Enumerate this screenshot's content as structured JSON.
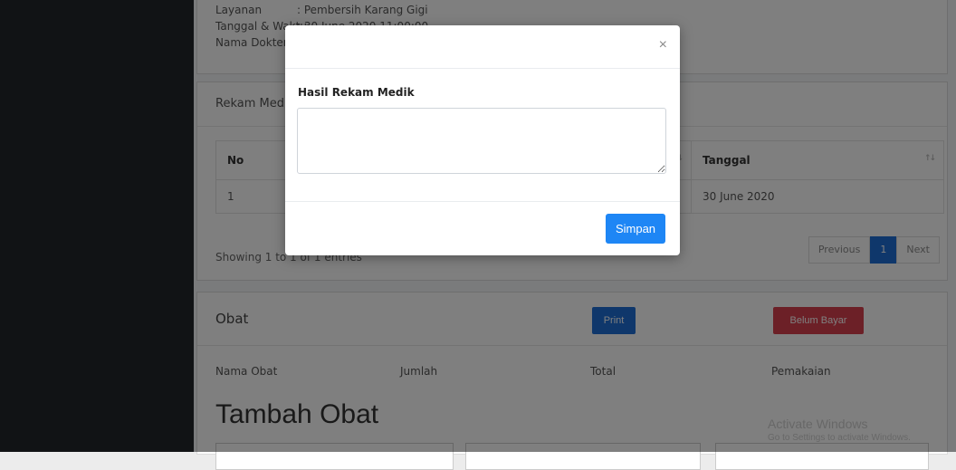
{
  "info": {
    "layanan_label": "Layanan",
    "layanan_value": ": Pembersih Karang Gigi",
    "tanggal_label": "Tanggal & Waktu",
    "tanggal_value": ": 30 June 2020 11:00:00",
    "dokter_label": "Nama Dokter"
  },
  "rekam": {
    "title": "Rekam Medik",
    "columns": [
      "No",
      "Tanggal"
    ],
    "rows": [
      {
        "no": "1",
        "tanggal": "30 June 2020"
      }
    ],
    "showing": "Showing 1 to 1 of 1 entries",
    "pager": {
      "previous": "Previous",
      "page": "1",
      "next": "Next"
    }
  },
  "obat": {
    "title": "Obat",
    "print_label": "Print",
    "status_label": "Belum Bayar",
    "columns": [
      "Nama Obat",
      "Jumlah",
      "Total",
      "Pemakaian"
    ],
    "tambah_title": "Tambah Obat"
  },
  "watermark": {
    "line1": "Activate Windows",
    "line2": "Go to Settings to activate Windows."
  },
  "modal": {
    "close_symbol": "×",
    "label": "Hasil Rekam Medik",
    "textarea_value": "",
    "save_label": "Simpan"
  },
  "colors": {
    "primary": "#1e86f5",
    "danger": "#d9414f",
    "sidebar": "#23272b"
  }
}
